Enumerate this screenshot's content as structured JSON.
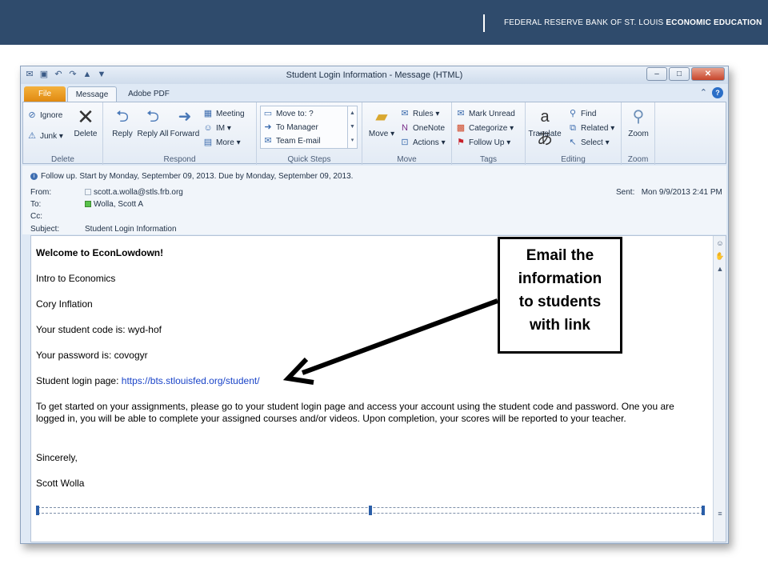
{
  "header": {
    "brand_normal": "FEDERAL RESERVE BANK OF ST. LOUIS",
    "brand_bold": "ECONOMIC EDUCATION",
    "color": "#2f4b6c"
  },
  "window": {
    "title": "Student Login Information  -  Message (HTML)",
    "tabs": {
      "file": "File",
      "message": "Message",
      "adobe": "Adobe PDF"
    }
  },
  "ribbon": {
    "delete_group": {
      "label": "Delete",
      "ignore": "Ignore",
      "junk": "Junk",
      "delete": "Delete"
    },
    "respond_group": {
      "label": "Respond",
      "reply": "Reply",
      "reply_all": "Reply All",
      "forward": "Forward",
      "meeting": "Meeting",
      "im": "IM",
      "more": "More"
    },
    "quicksteps_group": {
      "label": "Quick Steps",
      "move_to": "Move to: ?",
      "to_manager": "To Manager",
      "team_email": "Team E-mail"
    },
    "move_group": {
      "label": "Move",
      "move": "Move",
      "rules": "Rules",
      "onenote": "OneNote",
      "actions": "Actions"
    },
    "tags_group": {
      "label": "Tags",
      "mark_unread": "Mark Unread",
      "categorize": "Categorize",
      "follow_up": "Follow Up"
    },
    "editing_group": {
      "label": "Editing",
      "translate": "Translate",
      "find": "Find",
      "related": "Related",
      "select": "Select"
    },
    "zoom_group": {
      "label": "Zoom",
      "zoom": "Zoom"
    }
  },
  "message": {
    "follow_up": "Follow up.  Start by Monday, September 09, 2013.  Due by Monday, September 09, 2013.",
    "from_label": "From:",
    "from_value": "scott.a.wolla@stls.frb.org",
    "to_label": "To:",
    "to_value": "Wolla, Scott A",
    "cc_label": "Cc:",
    "subject_label": "Subject:",
    "subject_value": "Student Login Information",
    "sent_label": "Sent:",
    "sent_value": "Mon 9/9/2013 2:41 PM"
  },
  "body": {
    "greeting": "Welcome to EconLowdown!",
    "course": "Intro to Economics",
    "class_name": "Cory Inflation",
    "code_line": "Your student code is: wyd-hof",
    "password_line": "Your password is: covogyr",
    "login_prefix": "Student login page: ",
    "login_link": "https://bts.stlouisfed.org/student/",
    "instructions": "To get started on your assignments, please go to your student login page and access your account using the student code and password. One you are logged in, you will be able to complete your assigned courses and/or videos. Upon completion, your scores will be reported to your teacher.",
    "closing": "Sincerely,",
    "signature": "Scott Wolla"
  },
  "callout": {
    "line1": "Email the",
    "line2": "information",
    "line3": "to students",
    "line4": "with link"
  }
}
